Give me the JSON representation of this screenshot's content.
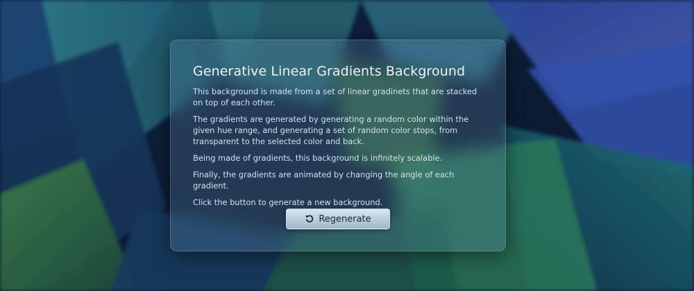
{
  "background": {
    "colors": [
      "#0b1a2e",
      "#1e3a66",
      "#2a6f7d",
      "#3a7a4a",
      "#2c4a9a",
      "#4a5aa8"
    ]
  },
  "panel": {
    "title": "Generative Linear Gradients Background",
    "paragraphs": [
      "This background is made from a set of linear gradinets that are stacked on top of each other.",
      "The gradients are generated by generating a random color within the given hue range, and generating a set of random color stops, from transparent to the selected color and back.",
      "Being made of gradients, this background is infinitely scalable.",
      "Finally, the gradients are animated by changing the angle of each gradient.",
      "Click the button to generate a new background."
    ],
    "button": {
      "label": "Regenerate",
      "icon": "refresh-icon"
    }
  }
}
